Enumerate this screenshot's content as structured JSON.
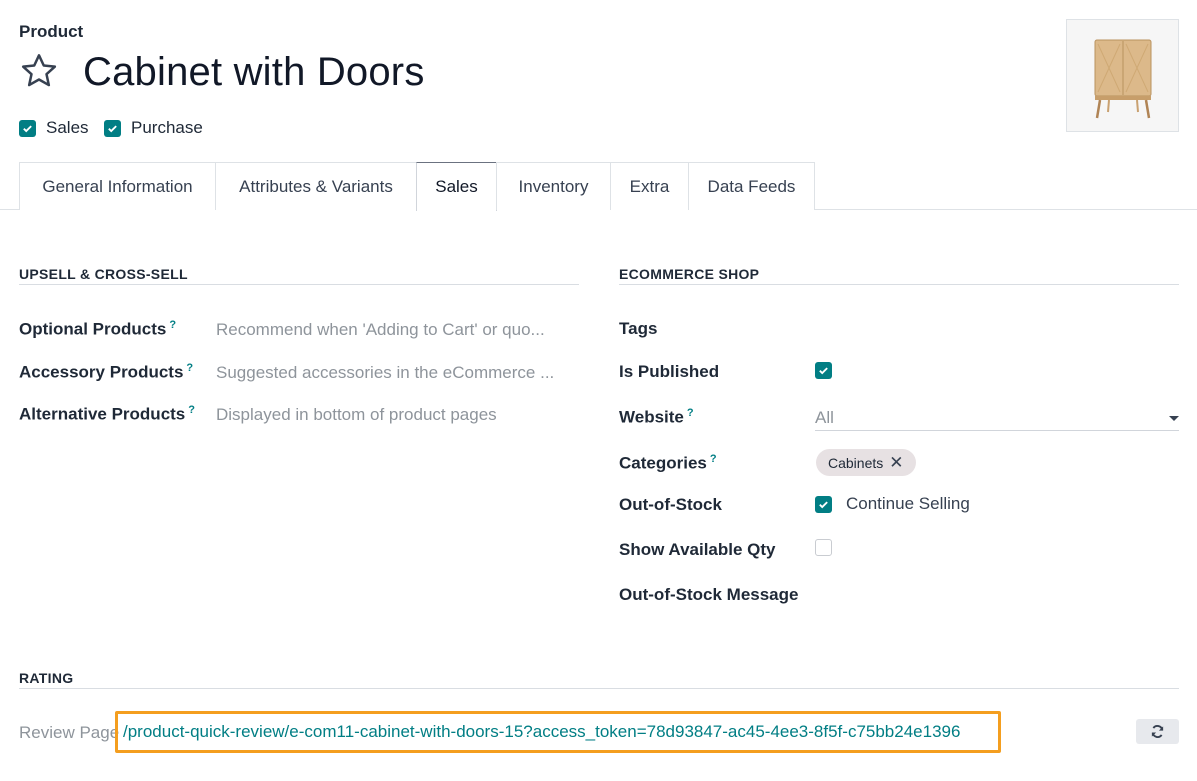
{
  "breadcrumb": "Product",
  "title": "Cabinet with Doors",
  "checkboxes": [
    {
      "label": "Sales",
      "checked": true
    },
    {
      "label": "Purchase",
      "checked": true
    }
  ],
  "tabs": [
    {
      "label": "General Information",
      "active": false
    },
    {
      "label": "Attributes & Variants",
      "active": false
    },
    {
      "label": "Sales",
      "active": true
    },
    {
      "label": "Inventory",
      "active": false
    },
    {
      "label": "Extra",
      "active": false
    },
    {
      "label": "Data Feeds",
      "active": false
    }
  ],
  "upsell": {
    "heading": "UPSELL & CROSS-SELL",
    "fields": [
      {
        "label": "Optional Products",
        "help": "?",
        "placeholder": "Recommend when 'Adding to Cart' or quo..."
      },
      {
        "label": "Accessory Products",
        "help": "?",
        "placeholder": "Suggested accessories in the eCommerce ..."
      },
      {
        "label": "Alternative Products",
        "help": "?",
        "placeholder": "Displayed in bottom of product pages"
      }
    ]
  },
  "ecommerce": {
    "heading": "ECOMMERCE SHOP",
    "tags_label": "Tags",
    "is_published_label": "Is Published",
    "is_published": true,
    "website_label": "Website",
    "website_help": "?",
    "website_value": "All",
    "categories_label": "Categories",
    "categories_help": "?",
    "category_tag": "Cabinets",
    "tag_remove": "✕",
    "out_of_stock_label": "Out-of-Stock",
    "continue_selling_label": "Continue Selling",
    "continue_selling": true,
    "show_qty_label": "Show Available Qty",
    "show_qty": false,
    "oos_message_label": "Out-of-Stock Message"
  },
  "rating": {
    "heading": "RATING",
    "review_label": "Review Page",
    "review_url": "/product-quick-review/e-com11-cabinet-with-doors-15?access_token=78d93847-ac45-4ee3-8f5f-c75bb24e1396"
  },
  "colors": {
    "accent": "#017e84",
    "highlight": "#f49e1f"
  },
  "icons": {
    "favorite": "star-outline-icon",
    "refresh": "refresh-icon"
  }
}
